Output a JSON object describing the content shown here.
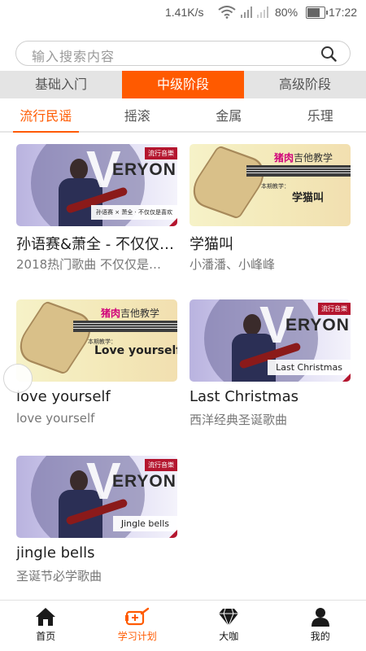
{
  "status_bar": {
    "speed": "1.41K/s",
    "battery": "80%",
    "battery_level": 0.8,
    "time": "17:22"
  },
  "search": {
    "placeholder": "输入搜索内容"
  },
  "level_tabs": [
    {
      "label": "基础入门",
      "active": false
    },
    {
      "label": "中级阶段",
      "active": true
    },
    {
      "label": "高级阶段",
      "active": false
    }
  ],
  "category_tabs": [
    {
      "label": "流行民谣",
      "active": true
    },
    {
      "label": "摇滚",
      "active": false
    },
    {
      "label": "金属",
      "active": false
    },
    {
      "label": "乐理",
      "active": false
    }
  ],
  "cards": [
    {
      "title": "孙语赛&萧全 - 不仅仅…",
      "subtitle": "2018热门歌曲 不仅仅是…",
      "thumb": {
        "style": "veryon",
        "brand": "ERYON",
        "v": "V",
        "tag": "流行音樂",
        "strip": "孙语赛 × 萧全 · 不仅仅是喜欢"
      }
    },
    {
      "title": "学猫叫",
      "subtitle": "小潘潘、小峰峰",
      "thumb": {
        "style": "lesson",
        "head_highlight": "猪肉",
        "head_rest": "吉他教学",
        "note": "本期教学：",
        "song": "学猫叫"
      }
    },
    {
      "title": "love yourself",
      "subtitle": "love yourself",
      "thumb": {
        "style": "lesson",
        "head_highlight": "猪肉",
        "head_rest": "吉他教学",
        "note": "本期教学：",
        "song": "Love yourself"
      }
    },
    {
      "title": "Last Christmas",
      "subtitle": "西洋经典圣诞歌曲",
      "thumb": {
        "style": "veryon",
        "brand": "ERYON",
        "v": "V",
        "tag": "流行音樂",
        "strip": "Last Christmas"
      }
    },
    {
      "title": "jingle bells",
      "subtitle": "圣诞节必学歌曲",
      "thumb": {
        "style": "veryon",
        "brand": "ERYON",
        "v": "V",
        "tag": "流行音樂",
        "strip": "Jingle bells"
      }
    }
  ],
  "bottom_nav": [
    {
      "label": "首页",
      "icon": "home-icon",
      "active": false
    },
    {
      "label": "学习计划",
      "icon": "guitar-plan-icon",
      "active": true
    },
    {
      "label": "大咖",
      "icon": "diamond-icon",
      "active": false
    },
    {
      "label": "我的",
      "icon": "person-icon",
      "active": false
    }
  ],
  "colors": {
    "accent": "#ff5a00",
    "tab_bar_bg": "#e4e4e4",
    "tag_red": "#b4152e"
  }
}
